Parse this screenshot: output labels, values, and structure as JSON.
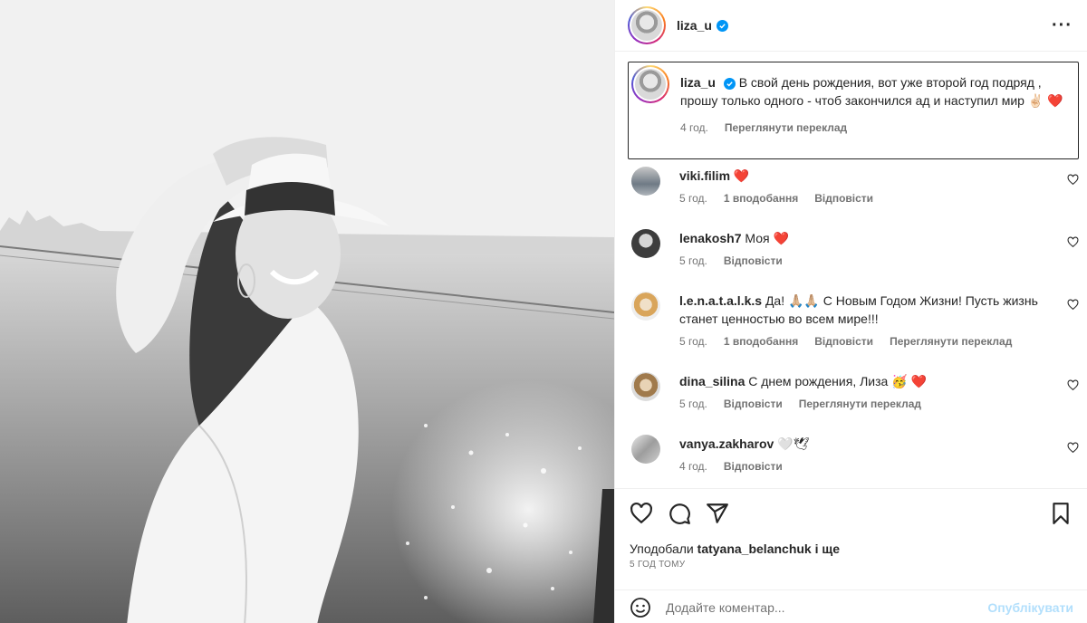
{
  "post": {
    "author": "liza_u",
    "more_icon": "more-horizontal-icon",
    "caption": {
      "author": "liza_u",
      "text": "В свой день рождения, вот уже второй год подряд , прошу только одного - чтоб закончился ад и наступил мир ✌🏻 ❤️",
      "time": "4 год.",
      "translate": "Переглянути переклад"
    }
  },
  "comments": [
    {
      "user": "viki.filim",
      "text": "❤️",
      "time": "5 год.",
      "likes": "1 вподобання",
      "reply": "Відповісти",
      "translate": ""
    },
    {
      "user": "lenakosh7",
      "text": "Моя ❤️",
      "time": "5 год.",
      "likes": "",
      "reply": "Відповісти",
      "translate": ""
    },
    {
      "user": "l.e.n.a.t.a.l.k.s",
      "text": "Да! 🙏🏼🙏🏼 С Новым Годом Жизни! Пусть жизнь станет ценностью во всем мире!!!",
      "time": "5 год.",
      "likes": "1 вподобання",
      "reply": "Відповісти",
      "translate": "Переглянути переклад"
    },
    {
      "user": "dina_silina",
      "text": "С днем рождения, Лиза 🥳 ❤️",
      "time": "5 год.",
      "likes": "",
      "reply": "Відповісти",
      "translate": "Переглянути переклад"
    },
    {
      "user": "vanya.zakharov",
      "text": "🤍🕊",
      "time": "4 год.",
      "likes": "",
      "reply": "Відповісти",
      "translate": ""
    }
  ],
  "footer": {
    "liked_prefix": "Уподобали",
    "liked_user": "tatyana_belanchuk",
    "liked_suffix": "і ще",
    "time": "5 ГОД ТОМУ",
    "comment_placeholder": "Додайте коментар...",
    "publish": "Опублікувати"
  },
  "colors": {
    "accent": "#0095f6",
    "heart": "#ed4956",
    "publish_disabled": "#b2dffc"
  }
}
